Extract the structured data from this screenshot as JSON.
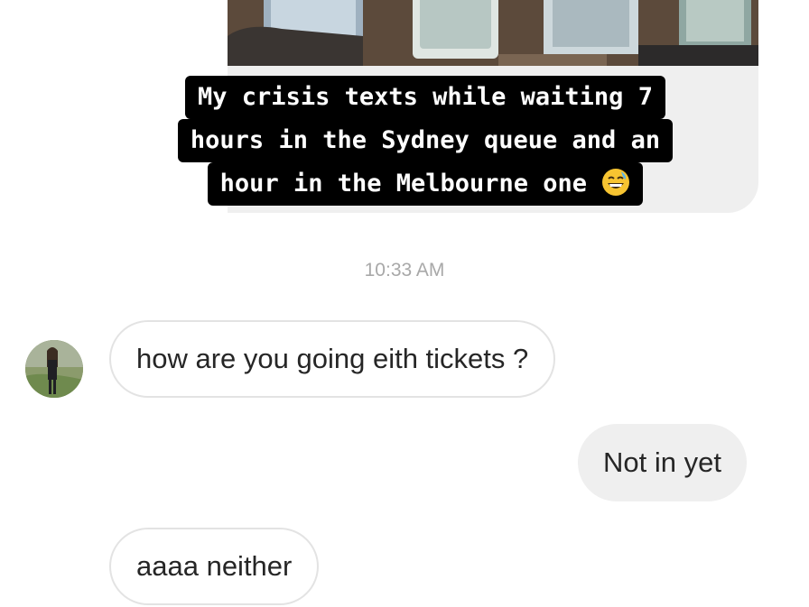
{
  "caption": {
    "lines": [
      "My crisis texts while waiting 7",
      "hours in the Sydney queue and an",
      "hour in the Melbourne one"
    ],
    "emoji": "grinning-face-with-sweat"
  },
  "timestamp": "10:33 AM",
  "messages": [
    {
      "direction": "received",
      "text": "how are you going eith tickets ?"
    },
    {
      "direction": "sent",
      "text": "Not in yet"
    },
    {
      "direction": "received",
      "text": "aaaa neither"
    }
  ],
  "avatar": {
    "alt": "contact avatar"
  },
  "colors": {
    "sent_bubble": "#efefef",
    "received_border": "#e3e3e3",
    "timestamp": "#a8a8a8",
    "caption_bg": "#000000"
  }
}
